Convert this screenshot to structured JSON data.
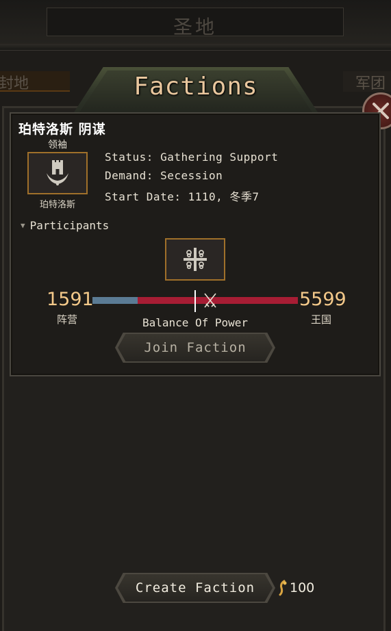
{
  "top": {
    "title": "圣地",
    "left_tab": "封地",
    "right_tab": "军团"
  },
  "header": {
    "title": "Factions"
  },
  "faction": {
    "name": "珀特洛斯 阴谋",
    "leader_label": "领袖",
    "leader_name": "珀特洛斯",
    "status": "Status: Gathering Support",
    "demand": "Demand: Secession",
    "start_date": "Start Date: 1110, 冬季7",
    "participants_label": "Participants"
  },
  "balance": {
    "left_value": "1591",
    "left_label": "阵营",
    "right_value": "5599",
    "right_label": "王国",
    "label": "Balance Of Power",
    "left_fraction": 0.22
  },
  "buttons": {
    "join": "Join Faction",
    "create": "Create Faction"
  },
  "cost": {
    "value": "100",
    "icon": "gold-icon"
  },
  "colors": {
    "accent_gold": "#f4c98a",
    "bar_red": "#a71d34",
    "bar_blue": "#5b7b94",
    "banner_border": "#a0702a"
  }
}
